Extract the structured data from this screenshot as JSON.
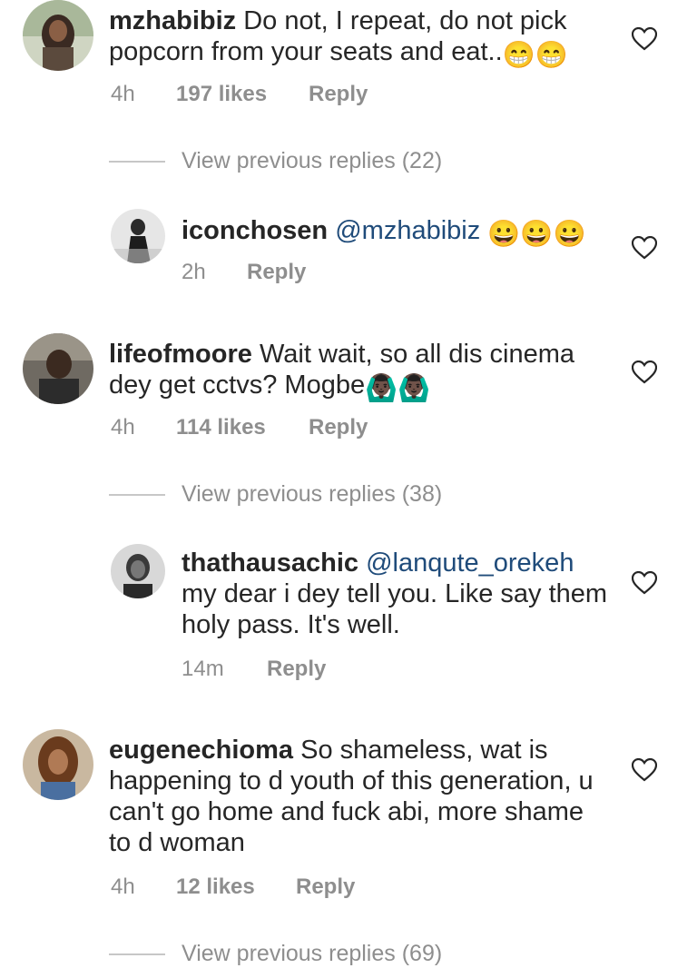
{
  "comments": [
    {
      "username": "mzhabibiz",
      "text": "Do not, I repeat, do not pick popcorn from your seats and eat..",
      "emojis": "😁😁",
      "time": "4h",
      "likes": "197 likes",
      "reply": "Reply",
      "view_replies": "View previous replies (22)",
      "reply_item": {
        "username": "iconchosen",
        "mention": "@mzhabibiz",
        "emojis": "😀😀😀",
        "time": "2h",
        "reply": "Reply"
      }
    },
    {
      "username": "lifeofmoore",
      "text": "Wait wait, so all dis cinema dey get cctvs? Mogbe",
      "emojis": "🙆🏿‍♂️🙆🏿‍♂️",
      "time": "4h",
      "likes": "114 likes",
      "reply": "Reply",
      "view_replies": "View previous replies (38)",
      "reply_item": {
        "username": "thathausachic",
        "mention": "@lanqute_orekeh",
        "text": "my dear i dey tell you.  Like say them holy pass. It's well.",
        "time": "14m",
        "reply": "Reply"
      }
    },
    {
      "username": "eugenechioma",
      "text": "So shameless, wat is happening to d youth of this generation, u can't go home and fuck abi, more shame to d woman",
      "time": "4h",
      "likes": "12 likes",
      "reply": "Reply",
      "view_replies": "View previous replies (69)"
    }
  ],
  "colors": {
    "text": "#262626",
    "meta": "#8e8e8e",
    "mention": "#1f4b7a"
  },
  "icons": {
    "like": "heart-outline-icon"
  }
}
